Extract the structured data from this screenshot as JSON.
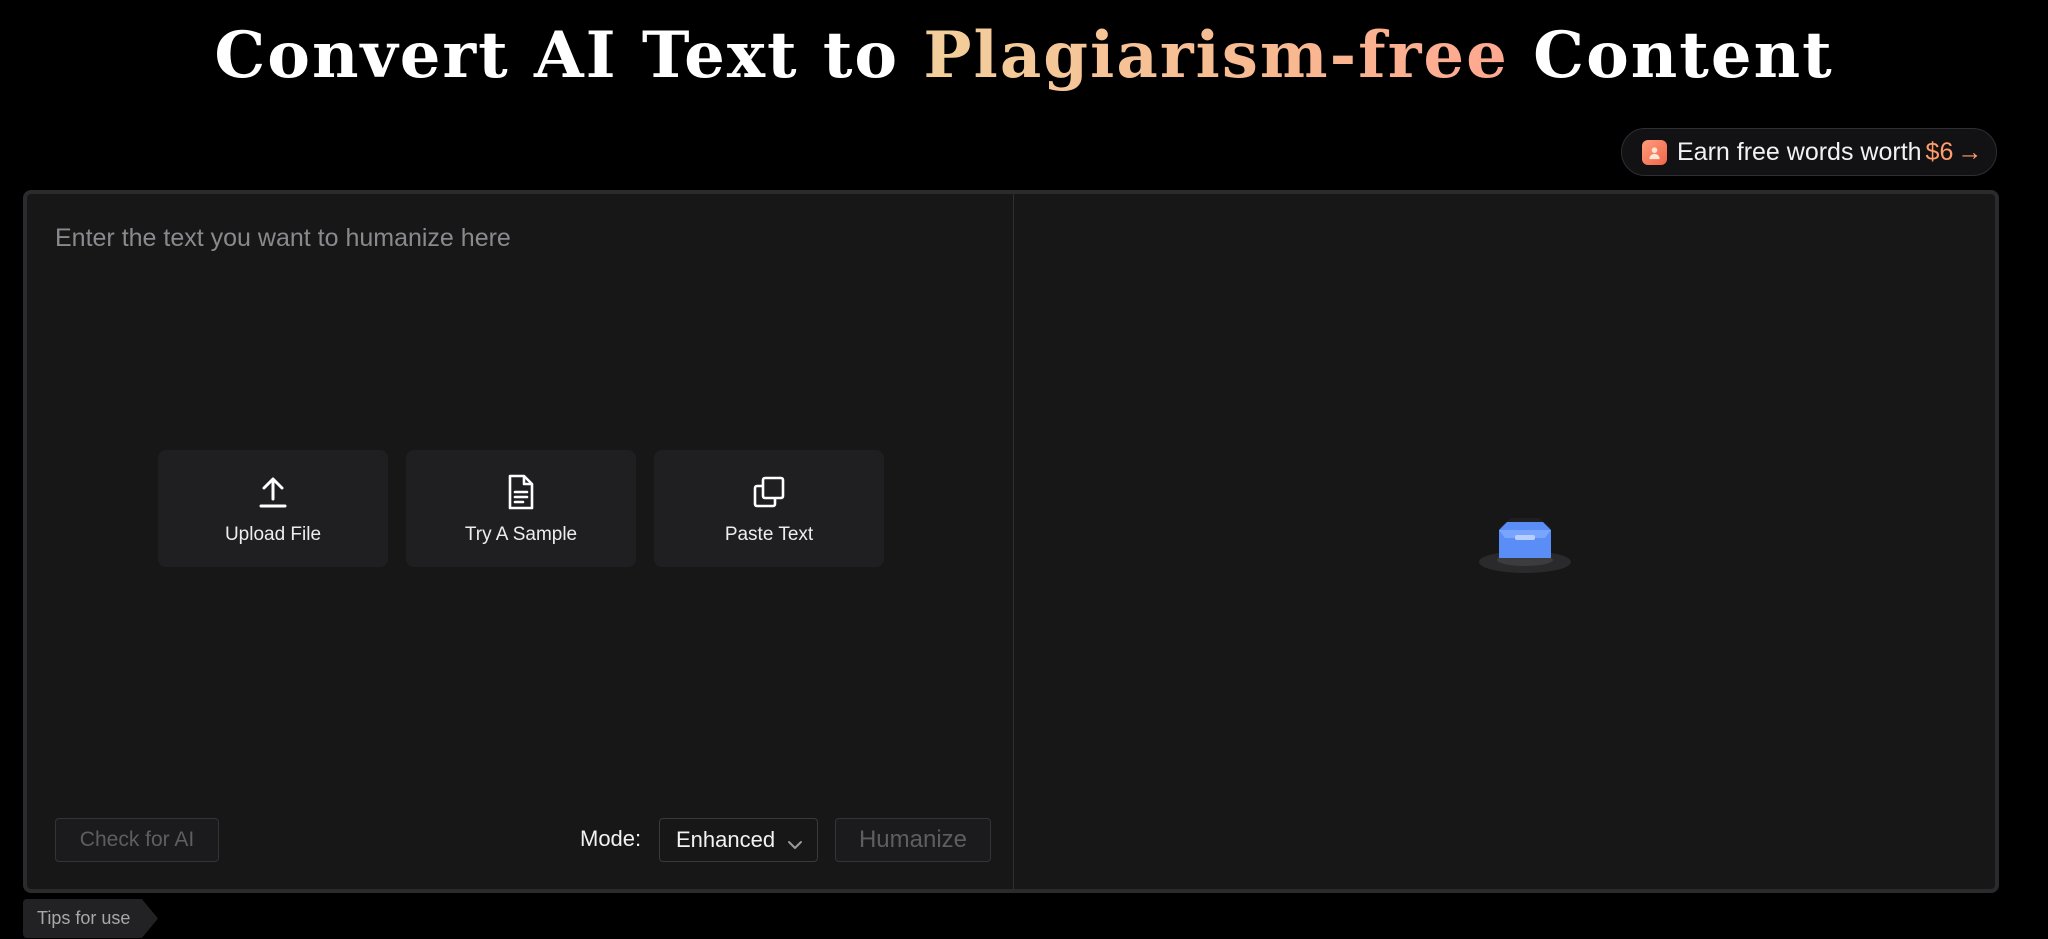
{
  "header": {
    "title_part1": "Convert AI Text to ",
    "title_accent": "Plagiarism-free",
    "title_part2": " Content"
  },
  "promo": {
    "label": "Earn free words worth",
    "amount": "$6",
    "arrow": "→",
    "icon": "gift-icon"
  },
  "editor": {
    "input_placeholder": "Enter the text you want to humanize here",
    "input_value": "",
    "actions": [
      {
        "label": "Upload File",
        "icon": "upload-icon"
      },
      {
        "label": "Try A Sample",
        "icon": "document-icon"
      },
      {
        "label": "Paste Text",
        "icon": "copy-icon"
      }
    ],
    "check_ai_label": "Check for AI",
    "mode_label": "Mode:",
    "mode_value": "Enhanced",
    "humanize_label": "Humanize",
    "empty_state_icon": "empty-box-icon"
  },
  "footer": {
    "tips_label": "Tips for use"
  },
  "colors": {
    "background": "#000000",
    "panel": "#171717",
    "accent_gradient_start": "#f3cf9c",
    "accent_gradient_end": "#ffa890",
    "promo_amount": "#ff9d6c",
    "illustration_blue": "#5b8df6"
  }
}
